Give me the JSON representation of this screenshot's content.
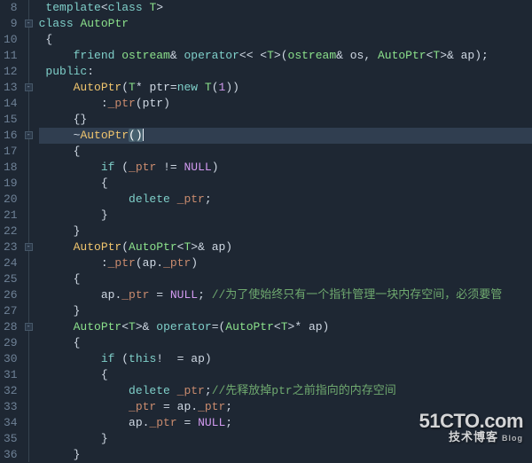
{
  "editor": {
    "first_line_number": 8,
    "highlighted_line_index": 8,
    "fold_markers": [
      {
        "line_index": 1,
        "glyph": "-"
      },
      {
        "line_index": 5,
        "glyph": "-"
      },
      {
        "line_index": 8,
        "glyph": "-"
      },
      {
        "line_index": 15,
        "glyph": "-"
      },
      {
        "line_index": 20,
        "glyph": "-"
      }
    ],
    "lines": [
      {
        "tokens": [
          {
            "t": " ",
            "c": "op"
          },
          {
            "t": "template",
            "c": "kw"
          },
          {
            "t": "<",
            "c": "punc"
          },
          {
            "t": "class",
            "c": "kw"
          },
          {
            "t": " ",
            "c": "op"
          },
          {
            "t": "T",
            "c": "type"
          },
          {
            "t": ">",
            "c": "punc"
          }
        ]
      },
      {
        "tokens": [
          {
            "t": "class",
            "c": "kw"
          },
          {
            "t": " ",
            "c": "op"
          },
          {
            "t": "AutoPtr",
            "c": "type"
          }
        ]
      },
      {
        "tokens": [
          {
            "t": " {",
            "c": "punc"
          }
        ]
      },
      {
        "tokens": [
          {
            "t": "     ",
            "c": "op"
          },
          {
            "t": "friend",
            "c": "kw"
          },
          {
            "t": " ",
            "c": "op"
          },
          {
            "t": "ostream",
            "c": "type"
          },
          {
            "t": "& ",
            "c": "op"
          },
          {
            "t": "operator",
            "c": "kw"
          },
          {
            "t": "<< <",
            "c": "op"
          },
          {
            "t": "T",
            "c": "type"
          },
          {
            "t": ">(",
            "c": "op"
          },
          {
            "t": "ostream",
            "c": "type"
          },
          {
            "t": "& ",
            "c": "op"
          },
          {
            "t": "os",
            "c": "id"
          },
          {
            "t": ", ",
            "c": "op"
          },
          {
            "t": "AutoPtr",
            "c": "type"
          },
          {
            "t": "<",
            "c": "op"
          },
          {
            "t": "T",
            "c": "type"
          },
          {
            "t": ">& ",
            "c": "op"
          },
          {
            "t": "ap",
            "c": "id"
          },
          {
            "t": ");",
            "c": "punc"
          }
        ]
      },
      {
        "tokens": [
          {
            "t": " ",
            "c": "op"
          },
          {
            "t": "public",
            "c": "kw"
          },
          {
            "t": ":",
            "c": "punc"
          }
        ]
      },
      {
        "tokens": [
          {
            "t": "     ",
            "c": "op"
          },
          {
            "t": "AutoPtr",
            "c": "fn"
          },
          {
            "t": "(",
            "c": "punc"
          },
          {
            "t": "T",
            "c": "type"
          },
          {
            "t": "* ",
            "c": "op"
          },
          {
            "t": "ptr",
            "c": "id"
          },
          {
            "t": "=",
            "c": "op"
          },
          {
            "t": "new",
            "c": "kw"
          },
          {
            "t": " ",
            "c": "op"
          },
          {
            "t": "T",
            "c": "type"
          },
          {
            "t": "(",
            "c": "punc"
          },
          {
            "t": "1",
            "c": "num"
          },
          {
            "t": "))",
            "c": "punc"
          }
        ]
      },
      {
        "tokens": [
          {
            "t": "         :",
            "c": "punc"
          },
          {
            "t": "_ptr",
            "c": "mem"
          },
          {
            "t": "(",
            "c": "punc"
          },
          {
            "t": "ptr",
            "c": "id"
          },
          {
            "t": ")",
            "c": "punc"
          }
        ]
      },
      {
        "tokens": [
          {
            "t": "     {}",
            "c": "punc"
          }
        ]
      },
      {
        "tokens": [
          {
            "t": "     ",
            "c": "op"
          },
          {
            "t": "~",
            "c": "op"
          },
          {
            "t": "AutoPtr",
            "c": "fn"
          },
          {
            "t": "(",
            "c": "punc br-hl"
          },
          {
            "t": ")",
            "c": "punc br-hl"
          },
          {
            "t": "",
            "c": "cursor"
          }
        ]
      },
      {
        "tokens": [
          {
            "t": "     {",
            "c": "punc"
          }
        ]
      },
      {
        "tokens": [
          {
            "t": "         ",
            "c": "op"
          },
          {
            "t": "if",
            "c": "kw"
          },
          {
            "t": " (",
            "c": "punc"
          },
          {
            "t": "_ptr",
            "c": "mem"
          },
          {
            "t": " != ",
            "c": "op"
          },
          {
            "t": "NULL",
            "c": "bool"
          },
          {
            "t": ")",
            "c": "punc"
          }
        ]
      },
      {
        "tokens": [
          {
            "t": "         {",
            "c": "punc"
          }
        ]
      },
      {
        "tokens": [
          {
            "t": "             ",
            "c": "op"
          },
          {
            "t": "delete",
            "c": "kw"
          },
          {
            "t": " ",
            "c": "op"
          },
          {
            "t": "_ptr",
            "c": "mem"
          },
          {
            "t": ";",
            "c": "punc"
          }
        ]
      },
      {
        "tokens": [
          {
            "t": "         }",
            "c": "punc"
          }
        ]
      },
      {
        "tokens": [
          {
            "t": "     }",
            "c": "punc"
          }
        ]
      },
      {
        "tokens": [
          {
            "t": "     ",
            "c": "op"
          },
          {
            "t": "AutoPtr",
            "c": "fn"
          },
          {
            "t": "(",
            "c": "punc"
          },
          {
            "t": "AutoPtr",
            "c": "type"
          },
          {
            "t": "<",
            "c": "op"
          },
          {
            "t": "T",
            "c": "type"
          },
          {
            "t": ">& ",
            "c": "op"
          },
          {
            "t": "ap",
            "c": "id"
          },
          {
            "t": ")",
            "c": "punc"
          }
        ]
      },
      {
        "tokens": [
          {
            "t": "         :",
            "c": "punc"
          },
          {
            "t": "_ptr",
            "c": "mem"
          },
          {
            "t": "(",
            "c": "punc"
          },
          {
            "t": "ap",
            "c": "id"
          },
          {
            "t": ".",
            "c": "op"
          },
          {
            "t": "_ptr",
            "c": "mem"
          },
          {
            "t": ")",
            "c": "punc"
          }
        ]
      },
      {
        "tokens": [
          {
            "t": "     {",
            "c": "punc"
          }
        ]
      },
      {
        "tokens": [
          {
            "t": "         ",
            "c": "op"
          },
          {
            "t": "ap",
            "c": "id"
          },
          {
            "t": ".",
            "c": "op"
          },
          {
            "t": "_ptr",
            "c": "mem"
          },
          {
            "t": " = ",
            "c": "op"
          },
          {
            "t": "NULL",
            "c": "bool"
          },
          {
            "t": "; ",
            "c": "punc"
          },
          {
            "t": "//为了使始终只有一个指针管理一块内存空间，必须要管",
            "c": "cmt"
          }
        ]
      },
      {
        "tokens": [
          {
            "t": "     }",
            "c": "punc"
          }
        ]
      },
      {
        "tokens": [
          {
            "t": "     ",
            "c": "op"
          },
          {
            "t": "AutoPtr",
            "c": "type"
          },
          {
            "t": "<",
            "c": "op"
          },
          {
            "t": "T",
            "c": "type"
          },
          {
            "t": ">& ",
            "c": "op"
          },
          {
            "t": "operator",
            "c": "kw"
          },
          {
            "t": "=(",
            "c": "op"
          },
          {
            "t": "AutoPtr",
            "c": "type"
          },
          {
            "t": "<",
            "c": "op"
          },
          {
            "t": "T",
            "c": "type"
          },
          {
            "t": ">* ",
            "c": "op"
          },
          {
            "t": "ap",
            "c": "id"
          },
          {
            "t": ")",
            "c": "punc"
          }
        ]
      },
      {
        "tokens": [
          {
            "t": "     {",
            "c": "punc"
          }
        ]
      },
      {
        "tokens": [
          {
            "t": "         ",
            "c": "op"
          },
          {
            "t": "if",
            "c": "kw"
          },
          {
            "t": " (",
            "c": "punc"
          },
          {
            "t": "this",
            "c": "kw"
          },
          {
            "t": "!",
            "c": "op"
          },
          {
            "t": "  = ",
            "c": "op"
          },
          {
            "t": "ap",
            "c": "id"
          },
          {
            "t": ")",
            "c": "punc"
          }
        ]
      },
      {
        "tokens": [
          {
            "t": "         {",
            "c": "punc"
          }
        ]
      },
      {
        "tokens": [
          {
            "t": "             ",
            "c": "op"
          },
          {
            "t": "delete",
            "c": "kw"
          },
          {
            "t": " ",
            "c": "op"
          },
          {
            "t": "_ptr",
            "c": "mem"
          },
          {
            "t": ";",
            "c": "punc"
          },
          {
            "t": "//先释放掉ptr之前指向的内存空间",
            "c": "cmt"
          }
        ]
      },
      {
        "tokens": [
          {
            "t": "             ",
            "c": "op"
          },
          {
            "t": "_ptr",
            "c": "mem"
          },
          {
            "t": " = ",
            "c": "op"
          },
          {
            "t": "ap",
            "c": "id"
          },
          {
            "t": ".",
            "c": "op"
          },
          {
            "t": "_ptr",
            "c": "mem"
          },
          {
            "t": ";",
            "c": "punc"
          }
        ]
      },
      {
        "tokens": [
          {
            "t": "             ",
            "c": "op"
          },
          {
            "t": "ap",
            "c": "id"
          },
          {
            "t": ".",
            "c": "op"
          },
          {
            "t": "_ptr",
            "c": "mem"
          },
          {
            "t": " = ",
            "c": "op"
          },
          {
            "t": "NULL",
            "c": "bool"
          },
          {
            "t": ";",
            "c": "punc"
          }
        ]
      },
      {
        "tokens": [
          {
            "t": "         }",
            "c": "punc"
          }
        ]
      },
      {
        "tokens": [
          {
            "t": "     }",
            "c": "punc"
          }
        ]
      }
    ]
  },
  "watermark": {
    "top": "51CTO.com",
    "bottom": "技术博客",
    "blog": "Blog"
  }
}
